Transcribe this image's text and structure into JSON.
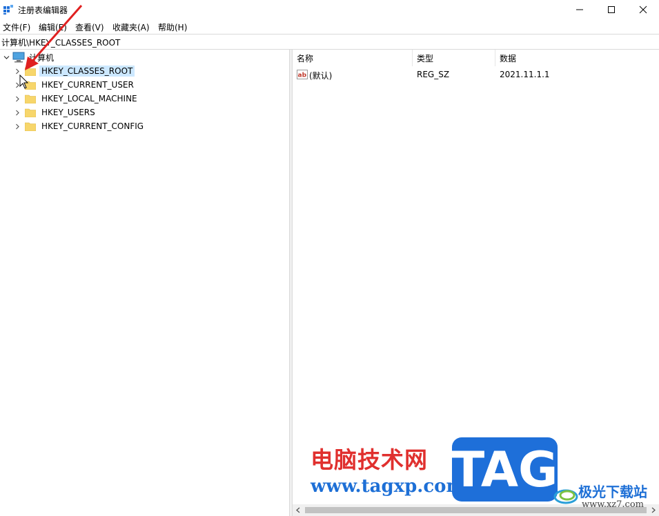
{
  "window": {
    "title": "注册表编辑器"
  },
  "menu": [
    {
      "label": "文件(F)"
    },
    {
      "label": "编辑(E)"
    },
    {
      "label": "查看(V)"
    },
    {
      "label": "收藏夹(A)"
    },
    {
      "label": "帮助(H)"
    }
  ],
  "address": {
    "path": "计算机\\HKEY_CLASSES_ROOT"
  },
  "tree": {
    "root": "计算机",
    "nodes": [
      {
        "label": "HKEY_CLASSES_ROOT"
      },
      {
        "label": "HKEY_CURRENT_USER"
      },
      {
        "label": "HKEY_LOCAL_MACHINE"
      },
      {
        "label": "HKEY_USERS"
      },
      {
        "label": "HKEY_CURRENT_CONFIG"
      }
    ]
  },
  "list": {
    "headers": [
      "名称",
      "类型",
      "数据"
    ],
    "rows": [
      {
        "name": "(默认)",
        "type": "REG_SZ",
        "data": "2021.11.1.1",
        "icon": "string-value-icon"
      }
    ]
  },
  "watermark": {
    "site_name": "电脑技术网",
    "url": "www.tagxp.com",
    "tag": "TAG",
    "secondary_name": "极光下载站",
    "secondary_url": "www.xz7.com"
  },
  "colors": {
    "selection": "#cce8ff",
    "folder": "#f7d66b",
    "accent": "#1e6fd9",
    "watermark_red": "#e0302e"
  }
}
